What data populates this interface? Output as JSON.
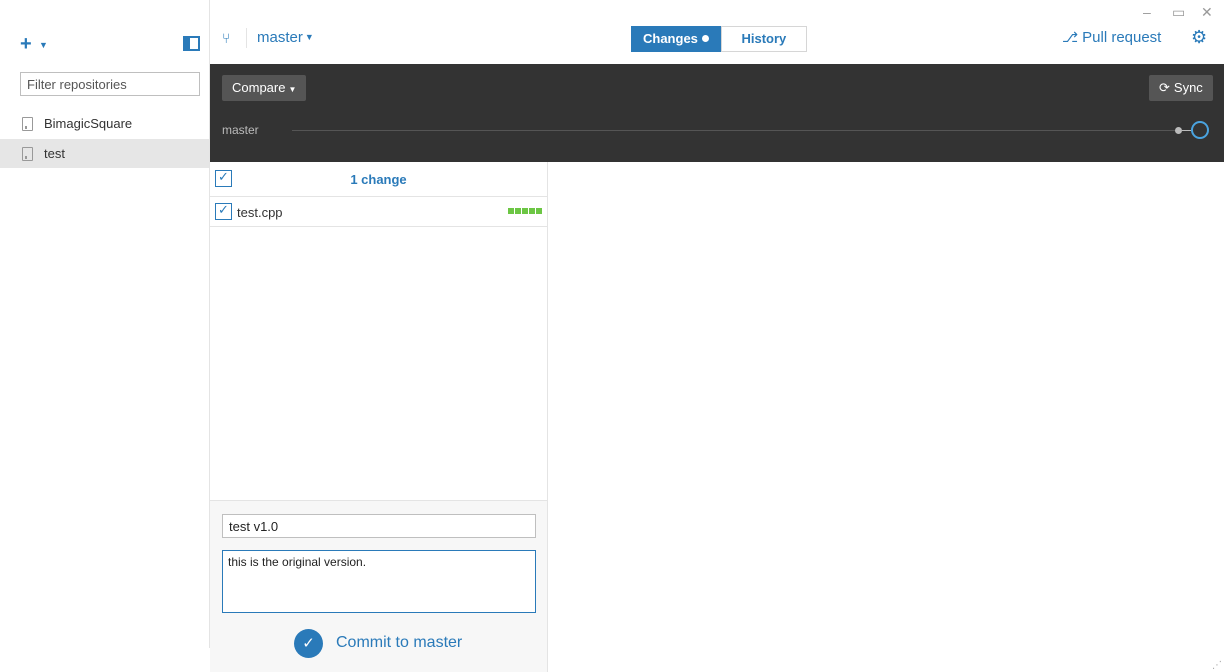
{
  "sidebar": {
    "add_icon": "plus-icon",
    "filter_placeholder": "Filter repositories",
    "repos": [
      {
        "name": "BimagicSquare",
        "selected": false
      },
      {
        "name": "test",
        "selected": true
      }
    ]
  },
  "topbar": {
    "branch": "master",
    "tabs": [
      {
        "label": "Changes",
        "active": true
      },
      {
        "label": "History",
        "active": false
      }
    ],
    "pull_request": "Pull request",
    "window_controls": [
      "minimize",
      "maximize",
      "close"
    ]
  },
  "compare_band": {
    "compare_label": "Compare",
    "sync_label": "Sync",
    "branch_label": "master"
  },
  "changes": {
    "count_label": "1 change",
    "files": [
      {
        "name": "test.cpp",
        "checked": true
      }
    ]
  },
  "commit": {
    "summary_value": "test v1.0",
    "description_value": "this is the original version.",
    "button_label": "Commit to master"
  },
  "colors": {
    "accent": "#2a7ab9",
    "band": "#333333",
    "additions": "#6cc644"
  }
}
